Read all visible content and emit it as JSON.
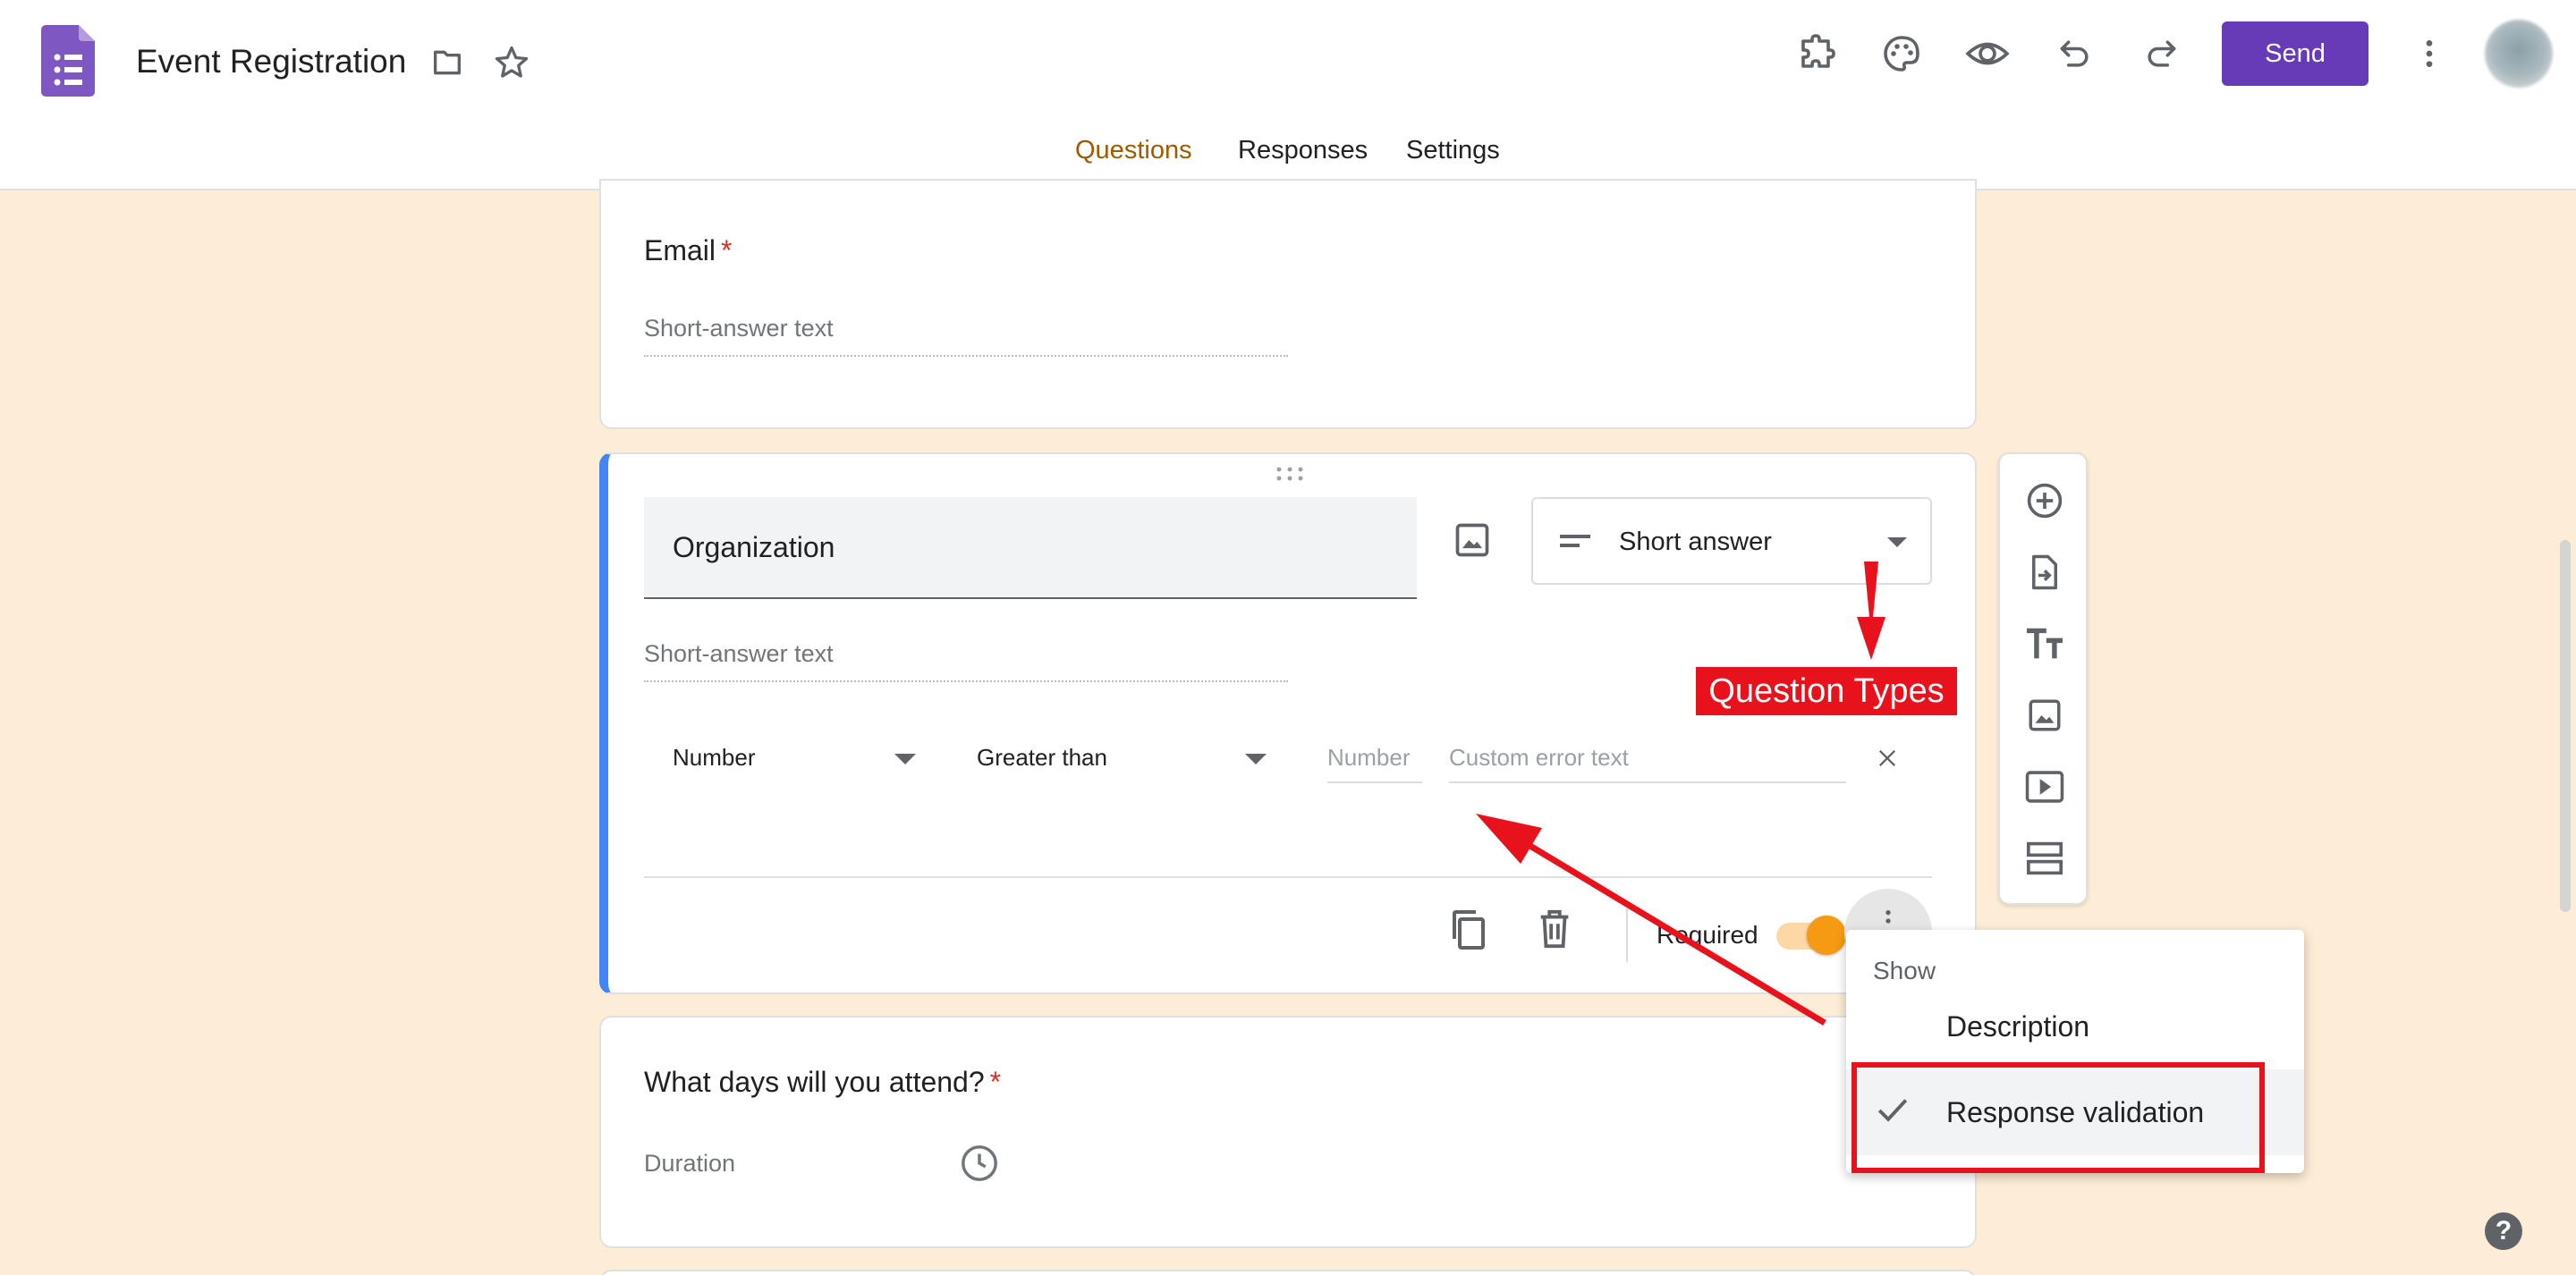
{
  "header": {
    "doc_title": "Event Registration",
    "send_label": "Send"
  },
  "tabs": [
    {
      "label": "Questions"
    },
    {
      "label": "Responses"
    },
    {
      "label": "Settings"
    }
  ],
  "questions": {
    "email": {
      "title": "Email",
      "required_mark": "*",
      "answer_placeholder": "Short-answer text"
    },
    "organization": {
      "title": "Organization",
      "type": "Short answer",
      "answer_placeholder": "Short-answer text",
      "validation": {
        "category": "Number",
        "condition": "Greater than",
        "value_placeholder": "Number",
        "error_placeholder": "Custom error text"
      },
      "required_label": "Required"
    },
    "days": {
      "title": "What days will you attend?",
      "required_mark": "*",
      "answer_placeholder": "Duration"
    }
  },
  "more_menu": {
    "header": "Show",
    "items": [
      {
        "label": "Description",
        "checked": false
      },
      {
        "label": "Response validation",
        "checked": true
      }
    ]
  },
  "annotations": {
    "question_types_label": "Question Types"
  },
  "colors": {
    "brand_purple": "#673ab7",
    "active_tab": "#a05a00",
    "page_background": "#fdecd6",
    "annotation_red": "#e8121c",
    "toggle_on": "#f59a12",
    "active_card_border": "#4285f4"
  },
  "icons": [
    "forms-logo-icon",
    "folder-icon",
    "star-icon",
    "addon-icon",
    "palette-icon",
    "preview-eye-icon",
    "undo-icon",
    "redo-icon",
    "more-vert-icon",
    "image-icon",
    "short-answer-icon",
    "dropdown-arrow-icon",
    "close-icon",
    "copy-icon",
    "trash-icon",
    "add-circle-icon",
    "import-question-icon",
    "title-text-icon",
    "add-image-icon",
    "add-video-icon",
    "add-section-icon",
    "check-icon",
    "clock-icon",
    "help-icon"
  ]
}
